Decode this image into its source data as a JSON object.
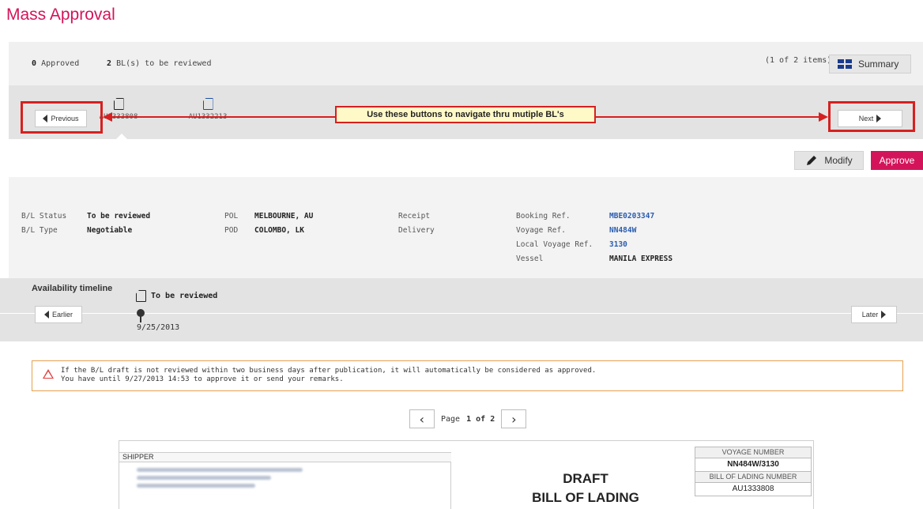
{
  "page_title": "Mass Approval",
  "summary": {
    "approved_count": "0",
    "approved_label": "Approved",
    "review_count": "2",
    "review_label": "BL(s) to be reviewed",
    "items_count": "(1 of 2 items)",
    "summary_button": "Summary"
  },
  "navigation": {
    "previous_label": "Previous",
    "next_label": "Next",
    "tabs": [
      {
        "label": "AU1333808"
      },
      {
        "label": "AU1332213"
      }
    ],
    "callout": "Use these buttons to navigate thru mutiple BL's"
  },
  "actions": {
    "modify_label": "Modify",
    "approve_label": "Approve"
  },
  "details": {
    "bl_status_label": "B/L Status",
    "bl_status_value": "To be reviewed",
    "bl_type_label": "B/L Type",
    "bl_type_value": "Negotiable",
    "pol_label": "POL",
    "pol_value": "MELBOURNE, AU",
    "pod_label": "POD",
    "pod_value": "COLOMBO, LK",
    "receipt_label": "Receipt",
    "delivery_label": "Delivery",
    "booking_ref_label": "Booking Ref.",
    "booking_ref_value": "MBE0203347",
    "voyage_ref_label": "Voyage Ref.",
    "voyage_ref_value": "NN484W",
    "local_voyage_label": "Local Voyage Ref.",
    "local_voyage_value": "3130",
    "vessel_label": "Vessel",
    "vessel_value": "MANILA EXPRESS"
  },
  "timeline": {
    "title": "Availability timeline",
    "earlier_label": "Earlier",
    "later_label": "Later",
    "status": "To be reviewed",
    "date": "9/25/2013"
  },
  "alert": {
    "line1": "If the B/L draft is not reviewed within two business days after publication, it will automatically be considered as approved.",
    "line2": "You have until 9/27/2013 14:53 to approve it or send your remarks."
  },
  "pager": {
    "page_label": "Page",
    "page_value": "1 of 2"
  },
  "document": {
    "shipper_label": "SHIPPER",
    "title_line1": "DRAFT",
    "title_line2": "BILL OF LADING",
    "voyage_number_label": "VOYAGE NUMBER",
    "voyage_number_value": "NN484W/3130",
    "bl_number_label": "BILL OF LADING NUMBER",
    "bl_number_value": "AU1333808"
  },
  "colors": {
    "brand": "#d4145a",
    "annotation": "#d62020",
    "link": "#2a5db0",
    "warning_border": "#e5a14f"
  }
}
